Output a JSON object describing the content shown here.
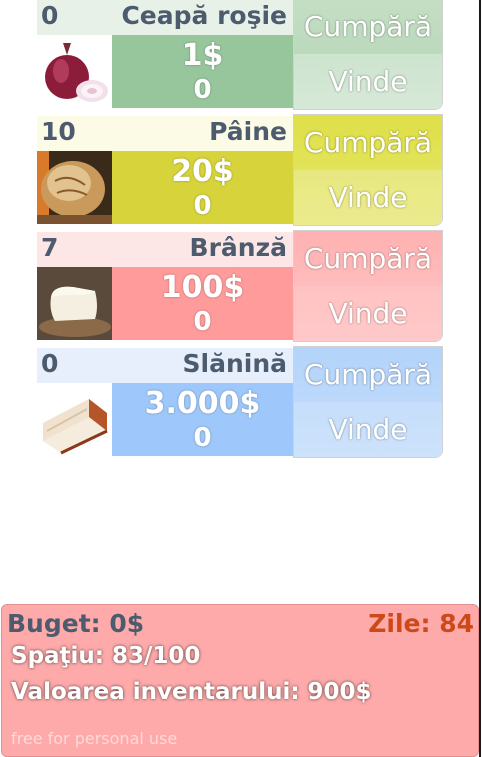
{
  "products": [
    {
      "quantity": "0",
      "name": "Ceapă roşie",
      "price": "1$",
      "owned": "0",
      "buy_label": "Cumpără",
      "sell_label": "Vinde",
      "colors": {
        "strip": "#e8f1e8",
        "price": "#98c69c",
        "buy": "#c4dfc4",
        "sell": "#cde4cf"
      }
    },
    {
      "quantity": "10",
      "name": "Pâine",
      "price": "20$",
      "owned": "0",
      "buy_label": "Cumpără",
      "sell_label": "Vinde",
      "colors": {
        "strip": "#fbfbe6",
        "price": "#d6d43a",
        "buy": "#e1e150",
        "sell": "#e8e880"
      }
    },
    {
      "quantity": "7",
      "name": "Brânză",
      "price": "100$",
      "owned": "0",
      "buy_label": "Cumpără",
      "sell_label": "Vinde",
      "colors": {
        "strip": "#fde6e6",
        "price": "#ff9b9b",
        "buy": "#ffb6b6",
        "sell": "#ffc2c2"
      }
    },
    {
      "quantity": "0",
      "name": "Slănină",
      "price": "3.000$",
      "owned": "0",
      "buy_label": "Cumpără",
      "sell_label": "Vinde",
      "colors": {
        "strip": "#e6effb",
        "price": "#9ec8fb",
        "buy": "#b8d6fa",
        "sell": "#c6defb"
      }
    }
  ],
  "status": {
    "budget": "Buget: 0$",
    "days": "Zile: 84",
    "space": "Spaţiu: 83/100",
    "inventory_value": "Valoarea inventarului: 900$",
    "watermark": "free for personal use"
  }
}
